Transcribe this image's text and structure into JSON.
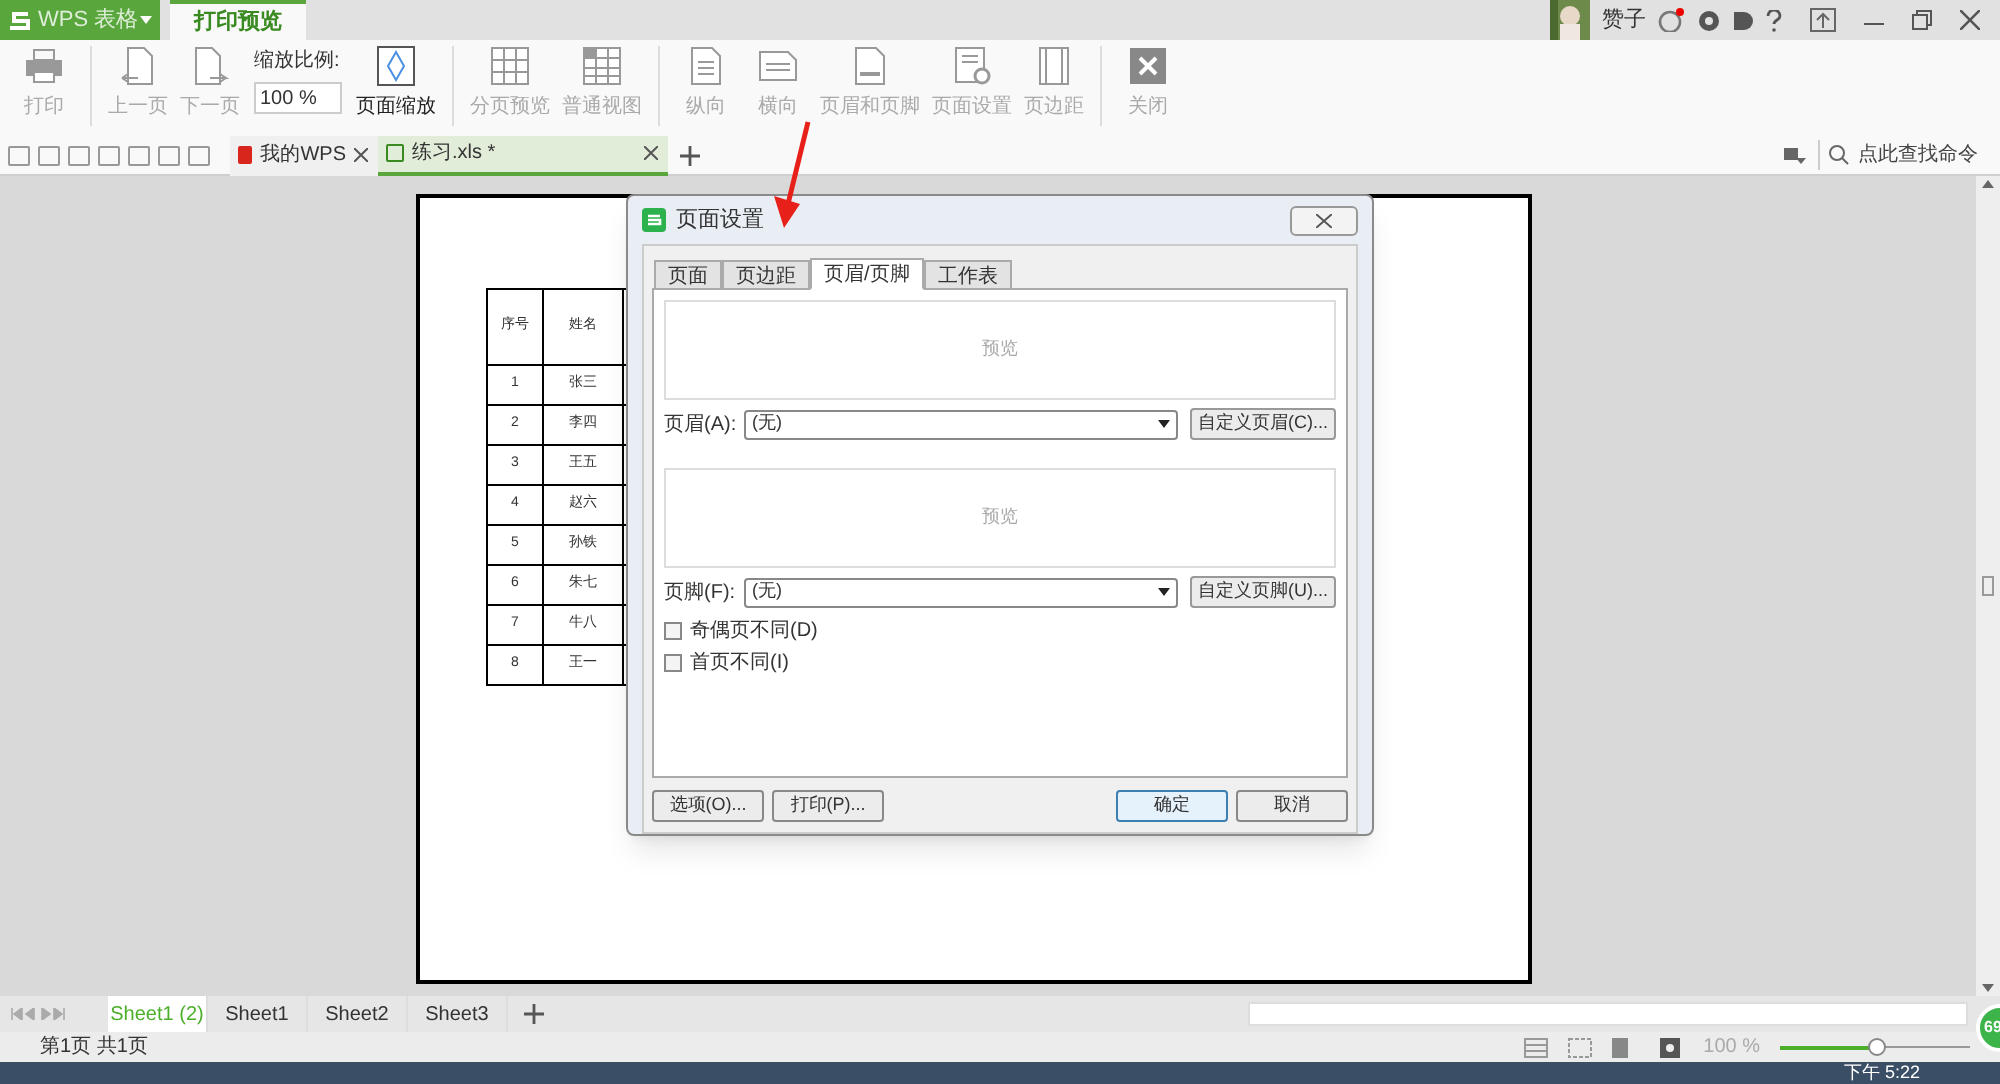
{
  "app": {
    "menu_button": "WPS 表格",
    "tabs": [
      {
        "label": "打印预览",
        "selected": true
      }
    ]
  },
  "user": {
    "name": "赞子"
  },
  "toolbar": {
    "items": [
      {
        "kind": "big",
        "label": "打印",
        "disabled": true
      },
      {
        "kind": "big",
        "label": "上一页",
        "disabled": true
      },
      {
        "kind": "big",
        "label": "下一页",
        "disabled": true
      },
      {
        "kind": "zoom",
        "label": "缩放比例:",
        "value": "100 %"
      },
      {
        "kind": "big",
        "label": "页面缩放",
        "disabled": false
      },
      {
        "kind": "big",
        "label": "分页预览",
        "disabled": true
      },
      {
        "kind": "big",
        "label": "普通视图",
        "disabled": true
      },
      {
        "kind": "big",
        "label": "纵向",
        "disabled": true
      },
      {
        "kind": "big",
        "label": "横向",
        "disabled": true
      },
      {
        "kind": "big",
        "label": "页眉和页脚",
        "disabled": true
      },
      {
        "kind": "big",
        "label": "页面设置",
        "disabled": true
      },
      {
        "kind": "big",
        "label": "页边距",
        "disabled": true
      },
      {
        "kind": "big",
        "label": "关闭",
        "disabled": true
      }
    ]
  },
  "doc_tabs": [
    {
      "label": "我的WPS",
      "selected": false
    },
    {
      "label": "练习.xls *",
      "selected": true
    }
  ],
  "command_search": {
    "placeholder": "点此查找命令"
  },
  "sheet": {
    "columns": [
      "序号",
      "姓名"
    ],
    "rows": [
      [
        "1",
        "张三"
      ],
      [
        "2",
        "李四"
      ],
      [
        "3",
        "王五"
      ],
      [
        "4",
        "赵六"
      ],
      [
        "5",
        "孙铁"
      ],
      [
        "6",
        "朱七"
      ],
      [
        "7",
        "牛八"
      ],
      [
        "8",
        "王一"
      ]
    ]
  },
  "dialog": {
    "title": "页面设置",
    "tabs": [
      {
        "label": "页面",
        "selected": false
      },
      {
        "label": "页边距",
        "selected": false
      },
      {
        "label": "页眉/页脚",
        "selected": true
      },
      {
        "label": "工作表",
        "selected": false
      }
    ],
    "sections": [
      {
        "preview": "预览",
        "label": "页眉(A):",
        "value": "(无)",
        "button": "自定义页眉(C)..."
      },
      {
        "preview": "预览",
        "label": "页脚(F):",
        "value": "(无)",
        "button": "自定义页脚(U)..."
      }
    ],
    "checkboxes": [
      {
        "label": "奇偶页不同(D)",
        "checked": false
      },
      {
        "label": "首页不同(I)",
        "checked": false
      }
    ],
    "left_buttons": [
      "选项(O)...",
      "打印(P)..."
    ],
    "right_buttons": [
      {
        "label": "确定",
        "default": true
      },
      {
        "label": "取消",
        "default": false
      }
    ]
  },
  "sheet_tabs": [
    {
      "label": "Sheet1 (2)",
      "selected": true
    },
    {
      "label": "Sheet1",
      "selected": false
    },
    {
      "label": "Sheet2",
      "selected": false
    },
    {
      "label": "Sheet3",
      "selected": false
    }
  ],
  "status_bar": {
    "page": "第1页 共1页",
    "zoom": "100 %",
    "zoom_slider": {
      "level": 0.5
    }
  },
  "taskbar": {
    "clock": "下午 5:22"
  },
  "float_badge": "69"
}
